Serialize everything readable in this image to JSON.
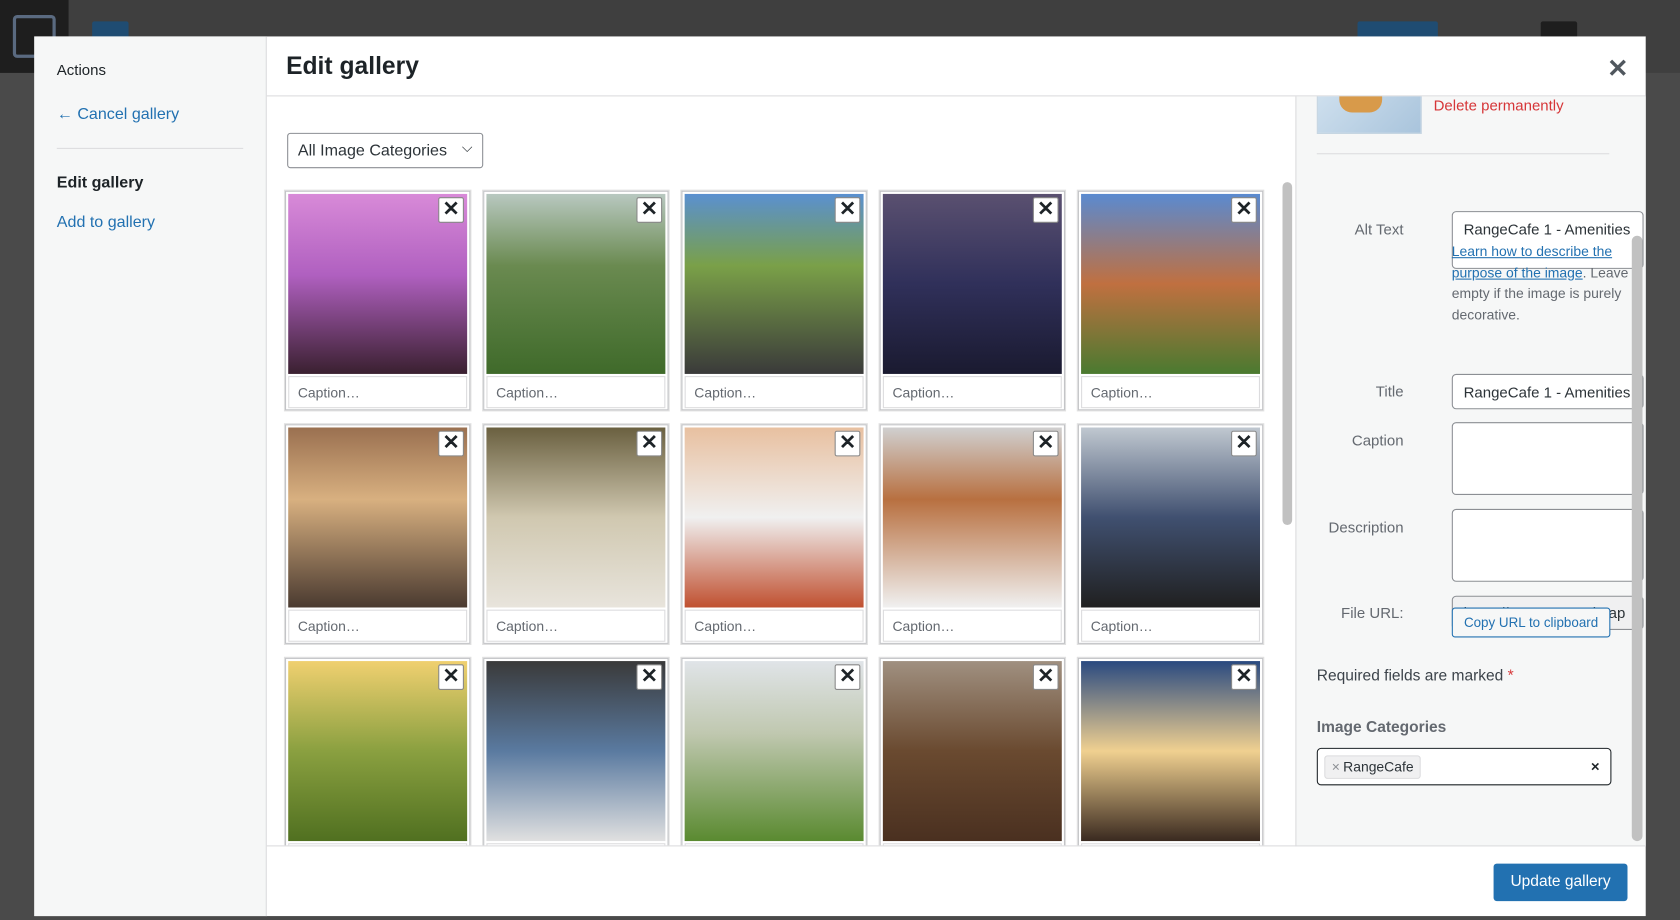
{
  "modal": {
    "title": "Edit gallery",
    "close_icon": "close-icon"
  },
  "menu": {
    "actions_heading": "Actions",
    "cancel_gallery": "← Cancel gallery",
    "edit_gallery": "Edit gallery",
    "add_to_gallery": "Add to gallery"
  },
  "filter": {
    "selected": "All Image Categories",
    "chevron": "⌵"
  },
  "gallery": {
    "caption_placeholder": "Caption…",
    "remove_icon": "✕",
    "items": [
      {
        "subject": "event-hall-purple"
      },
      {
        "subject": "golf-course"
      },
      {
        "subject": "golf-carts"
      },
      {
        "subject": "banquet-tables"
      },
      {
        "subject": "clubhouse-patio"
      },
      {
        "subject": "patio-chairs"
      },
      {
        "subject": "dining-room"
      },
      {
        "subject": "tent-event"
      },
      {
        "subject": "appetizers"
      },
      {
        "subject": "cocktail-party"
      },
      {
        "subject": "golf-tree"
      },
      {
        "subject": "bridal-party"
      },
      {
        "subject": "outdoor-tent"
      },
      {
        "subject": "lounge"
      },
      {
        "subject": "teepee-night"
      }
    ]
  },
  "details": {
    "delete_permanently": "Delete permanently",
    "alt_text_label": "Alt Text",
    "alt_text_value": "RangeCafe 1 - Amenities",
    "help_link": "Learn how to describe the purpose of the image",
    "help_rest": ". Leave empty if the image is purely decorative.",
    "title_label": "Title",
    "title_value": "RangeCafe 1 - Amenities",
    "caption_label": "Caption",
    "caption_value": "",
    "description_label": "Description",
    "description_value": "",
    "file_url_label": "File URL:",
    "file_url_value": "https://www.peacockgap",
    "copy_url": "Copy URL to clipboard",
    "required_text": "Required fields are marked",
    "required_star": "*",
    "image_categories": "Image Categories",
    "category_chip": "RangeCafe",
    "chip_remove": "×",
    "clear": "×"
  },
  "footer": {
    "update_gallery": "Update gallery"
  },
  "colors": {
    "primary": "#2271b1",
    "danger": "#d63638"
  }
}
